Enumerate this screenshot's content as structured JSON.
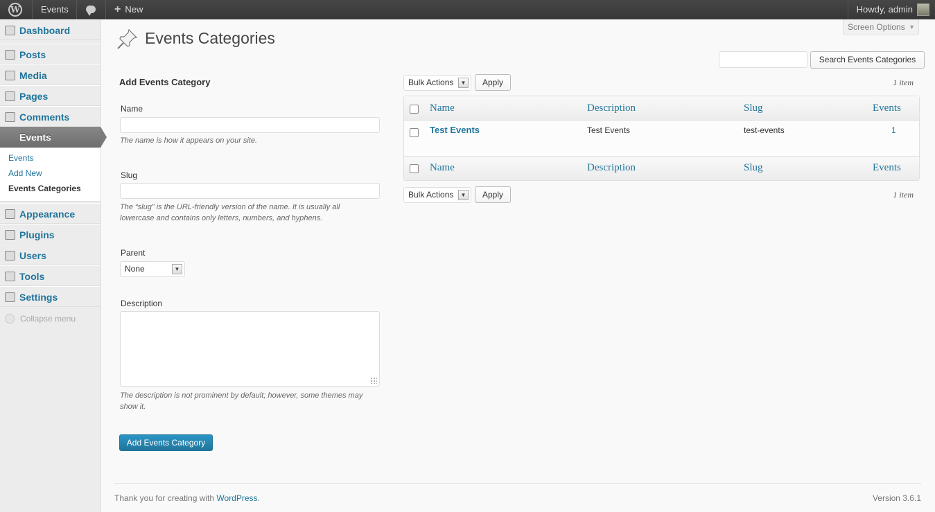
{
  "adminbar": {
    "site_name": "Events",
    "new_label": "New",
    "account_label": "Howdy, admin"
  },
  "menu": {
    "dashboard": "Dashboard",
    "posts": "Posts",
    "media": "Media",
    "pages": "Pages",
    "comments": "Comments",
    "events": "Events",
    "submenu": {
      "events": "Events",
      "add_new": "Add New",
      "categories": "Events Categories"
    },
    "appearance": "Appearance",
    "plugins": "Plugins",
    "users": "Users",
    "tools": "Tools",
    "settings": "Settings",
    "collapse": "Collapse menu"
  },
  "screen_options": "Screen Options",
  "page_title": "Events Categories",
  "search": {
    "value": "",
    "button": "Search Events Categories"
  },
  "form": {
    "heading": "Add Events Category",
    "name_label": "Name",
    "name_value": "",
    "name_help": "The name is how it appears on your site.",
    "slug_label": "Slug",
    "slug_value": "",
    "slug_help_1": "The “slug” is the URL-friendly version of the name. It is usually all",
    "slug_help_2": "lowercase and contains only letters, numbers, and hyphens.",
    "parent_label": "Parent",
    "parent_value": "None",
    "description_label": "Description",
    "description_value": "",
    "description_help_1": "The description is not prominent by default; however, some themes may",
    "description_help_2": "show it.",
    "submit": "Add Events Category"
  },
  "table": {
    "bulk_actions": "Bulk Actions",
    "apply": "Apply",
    "item_count": "1 item",
    "columns": [
      "Name",
      "Description",
      "Slug",
      "Events"
    ],
    "rows": [
      {
        "name": "Test Events",
        "description": "Test Events",
        "slug": "test-events",
        "count": "1"
      }
    ]
  },
  "footer": {
    "thanks_prefix": "Thank you for creating with ",
    "thanks_link": "WordPress",
    "thanks_suffix": ".",
    "version": "Version 3.6.1"
  },
  "colors": {
    "link": "#21759b",
    "primary_button": "#21759b",
    "adminbar": "#464646"
  }
}
